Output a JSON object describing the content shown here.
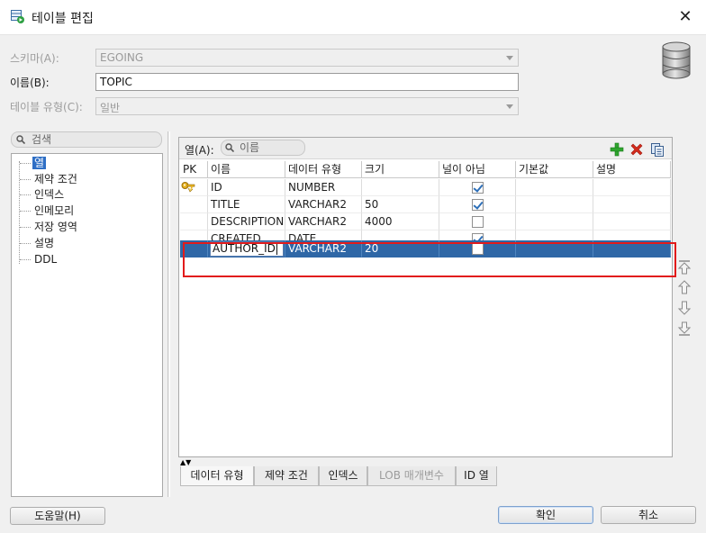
{
  "window": {
    "title": "테이블 편집",
    "close_glyph": "✕"
  },
  "form": {
    "schema": {
      "label": "스키마(A):",
      "value": "EGOING"
    },
    "name": {
      "label": "이름(B):",
      "value": "TOPIC"
    },
    "table_type": {
      "label": "테이블 유형(C):",
      "value": "일반"
    }
  },
  "left": {
    "search_placeholder": "검색",
    "items": [
      {
        "label": "열",
        "selected": true
      },
      {
        "label": "제약 조건"
      },
      {
        "label": "인덱스"
      },
      {
        "label": "인메모리"
      },
      {
        "label": "저장 영역"
      },
      {
        "label": "설명"
      },
      {
        "label": "DDL"
      }
    ]
  },
  "columns_panel": {
    "label": "열(A):",
    "search_placeholder": "이름",
    "toolbar_icons": [
      "add-icon",
      "delete-icon",
      "copy-icon"
    ],
    "headers": [
      "PK",
      "이름",
      "데이터 유형",
      "크기",
      "널이 아님",
      "기본값",
      "설명"
    ],
    "rows": [
      {
        "pk": true,
        "name": "ID",
        "type": "NUMBER",
        "size": "",
        "not_null": true,
        "default": "",
        "comment": ""
      },
      {
        "pk": false,
        "name": "TITLE",
        "type": "VARCHAR2",
        "size": "50",
        "not_null": true,
        "default": "",
        "comment": ""
      },
      {
        "pk": false,
        "name": "DESCRIPTION",
        "type": "VARCHAR2",
        "size": "4000",
        "not_null": false,
        "default": "",
        "comment": ""
      },
      {
        "pk": false,
        "name": "CREATED",
        "type": "DATE",
        "size": "",
        "not_null": true,
        "default": "",
        "comment": ""
      },
      {
        "pk": false,
        "name": "AUTHOR_ID",
        "type": "VARCHAR2",
        "size": "20",
        "not_null": false,
        "default": "",
        "comment": "",
        "selected": true,
        "editing": true
      }
    ],
    "side_buttons": [
      "move-top-icon",
      "move-up-icon",
      "move-down-icon",
      "move-bottom-icon"
    ]
  },
  "bottom_tabs": [
    {
      "label": "데이터 유형"
    },
    {
      "label": "제약 조건"
    },
    {
      "label": "인덱스"
    },
    {
      "label": "LOB 매개변수",
      "disabled": true
    },
    {
      "label": "ID 열"
    }
  ],
  "buttons": {
    "help": "도움말(H)",
    "ok": "확인",
    "cancel": "취소"
  },
  "colors": {
    "selection": "#2f67a6",
    "highlight_border": "#e21b1b",
    "checkbox_check": "#2d6fb8"
  }
}
